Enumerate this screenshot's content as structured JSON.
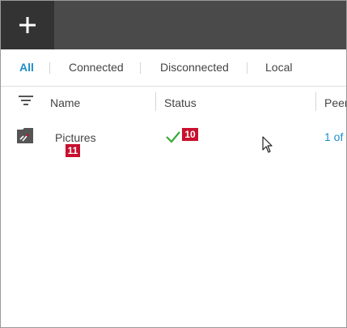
{
  "toolbar": {
    "add_icon": "plus-icon",
    "colors": {
      "topbar": "#4a4a4a",
      "add_button": "#333333"
    }
  },
  "filters": {
    "items": [
      {
        "label": "All",
        "active": true
      },
      {
        "label": "Connected",
        "active": false
      },
      {
        "label": "Disconnected",
        "active": false
      },
      {
        "label": "Local",
        "active": false
      }
    ],
    "accent_color": "#1e8fc7"
  },
  "table": {
    "filter_icon": "filter-icon",
    "columns": [
      "Name",
      "Status",
      "Peers"
    ],
    "rows": [
      {
        "icon": "folder-icon",
        "name": "Pictures",
        "status_icon": "checkmark-icon",
        "peers_visible": "1 of"
      }
    ]
  },
  "annotations": {
    "status_badge": "10",
    "name_badge": "11",
    "badge_color": "#c8102e"
  },
  "cursor": {
    "icon": "mouse-pointer-icon"
  }
}
